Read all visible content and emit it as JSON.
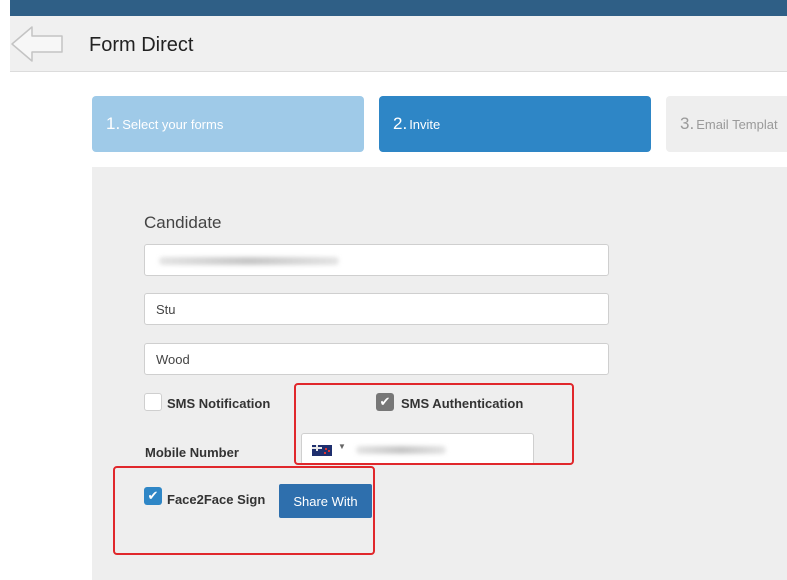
{
  "header": {
    "title": "Form Direct",
    "back_icon": "arrow-left-icon"
  },
  "steps": [
    {
      "num": "1.",
      "label": "Select your forms",
      "state": "completed"
    },
    {
      "num": "2.",
      "label": "Invite",
      "state": "active"
    },
    {
      "num": "3.",
      "label": "Email Templat",
      "state": "upcoming"
    }
  ],
  "form": {
    "candidate_label": "Candidate",
    "first_name": "Stu",
    "last_name": "Wood",
    "sms_notification": {
      "label": "SMS Notification",
      "checked": false
    },
    "sms_authentication": {
      "label": "SMS Authentication",
      "checked": true
    },
    "mobile": {
      "label": "Mobile Number",
      "flag": "nz-flag-icon"
    },
    "face2face": {
      "label": "Face2Face Sign",
      "checked": true
    },
    "share_button": "Share With"
  },
  "colors": {
    "topbar": "#2f5f86",
    "active_step": "#2e86c6",
    "completed_step": "#9fcae8",
    "annotation": "#e0272b"
  }
}
